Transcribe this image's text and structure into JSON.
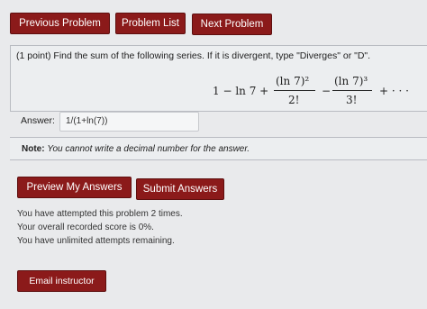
{
  "nav": {
    "previous": "Previous Problem",
    "list": "Problem List",
    "next": "Next Problem"
  },
  "problem": {
    "text": "(1 point) Find the sum of the following series. If it is divergent, type \"Diverges\" or \"D\".",
    "series": {
      "lead": "1 − ln 7 +",
      "term2_num": "(ln 7)²",
      "term2_den": "2!",
      "minus": "−",
      "term3_num": "(ln 7)³",
      "term3_den": "3!",
      "tail": "+ · · ·"
    }
  },
  "answer": {
    "label": "Answer:",
    "value": "1/(1+ln(7))"
  },
  "note": {
    "label": "Note:",
    "text": "You cannot write a decimal number for the answer."
  },
  "actions": {
    "preview": "Preview My Answers",
    "submit": "Submit Answers"
  },
  "status": {
    "attempts": "You have attempted this problem 2 times.",
    "score": "Your overall recorded score is 0%.",
    "remaining": "You have unlimited attempts remaining."
  },
  "email": "Email instructor",
  "colors": {
    "button_bg": "#8b1a1a",
    "page_bg": "#e9eaec"
  }
}
